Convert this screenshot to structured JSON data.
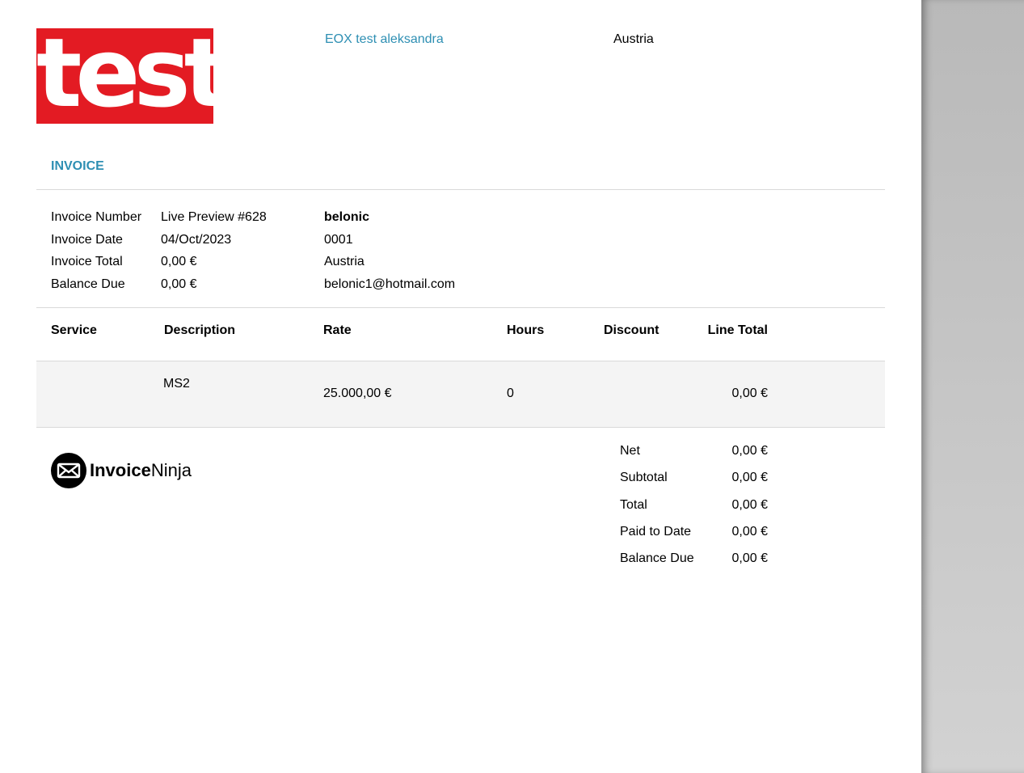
{
  "logo_text": "test",
  "company": {
    "name": "EOX test aleksandra",
    "country": "Austria"
  },
  "document_title": "INVOICE",
  "details": [
    {
      "label": "Invoice Number",
      "value": "Live Preview #628"
    },
    {
      "label": "Invoice Date",
      "value": "04/Oct/2023"
    },
    {
      "label": "Invoice Total",
      "value": "0,00 €"
    },
    {
      "label": "Balance Due",
      "value": "0,00 €"
    }
  ],
  "client": {
    "name": "belonic",
    "number": "0001",
    "country": "Austria",
    "email": "belonic1@hotmail.com"
  },
  "table": {
    "headers": [
      "Service",
      "Description",
      "Rate",
      "Hours",
      "Discount",
      "Line Total"
    ],
    "rows": [
      {
        "service": "",
        "description": "MS2",
        "rate": "25.000,00 €",
        "hours": "0",
        "discount": "",
        "line_total": "0,00 €"
      }
    ]
  },
  "footer_brand": {
    "bold": "Invoice",
    "light": "Ninja"
  },
  "totals": [
    {
      "label": "Net",
      "value": "0,00 €"
    },
    {
      "label": "Subtotal",
      "value": "0,00 €"
    },
    {
      "label": "Total",
      "value": "0,00 €"
    },
    {
      "label": "Paid to Date",
      "value": "0,00 €"
    },
    {
      "label": "Balance Due",
      "value": "0,00 €"
    }
  ],
  "colors": {
    "accent": "#2e8fb3",
    "logo_red": "#e31b23"
  }
}
